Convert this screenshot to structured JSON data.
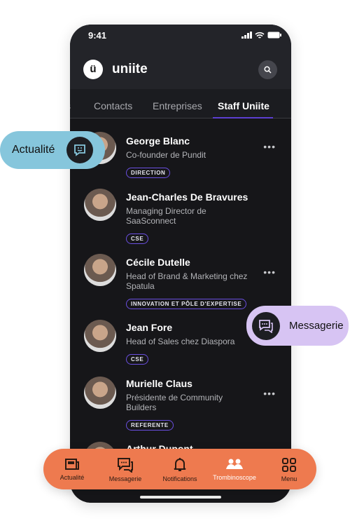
{
  "status": {
    "time": "9:41"
  },
  "header": {
    "logo": "ü",
    "brand": "uniite"
  },
  "tabs": [
    "s",
    "Contacts",
    "Entreprises",
    "Staff Uniite"
  ],
  "contacts": [
    {
      "name": "George Blanc",
      "role": "Co-founder de Pundit",
      "badge": "DIRECTION"
    },
    {
      "name": "Jean-Charles De Bravures",
      "role": "Managing Director de SaaSconnect",
      "badge": "CSE"
    },
    {
      "name": "Cécile Dutelle",
      "role": "Head of Brand & Marketing chez Spatula",
      "badge": "INNOVATION ET PÔLE D'EXPERTISE"
    },
    {
      "name": "Jean Fore",
      "role": "Head of Sales chez Diaspora",
      "badge": "CSE"
    },
    {
      "name": "Murielle Claus",
      "role": "Présidente de Community Builders",
      "badge": "REFERENTE"
    },
    {
      "name": "Arthur Dupont"
    }
  ],
  "more": "•••",
  "pills": {
    "actualite": "Actualité",
    "messagerie": "Messagerie"
  },
  "nav": [
    "Actualité",
    "Messagerie",
    "Notifications",
    "Trombinoscope",
    "Menu"
  ],
  "colors": {
    "accent": "#ee7a4f",
    "badge_border": "#6a4fe0",
    "actualite_pill": "#86c6dc",
    "messagerie_pill": "#d7c4f3"
  }
}
